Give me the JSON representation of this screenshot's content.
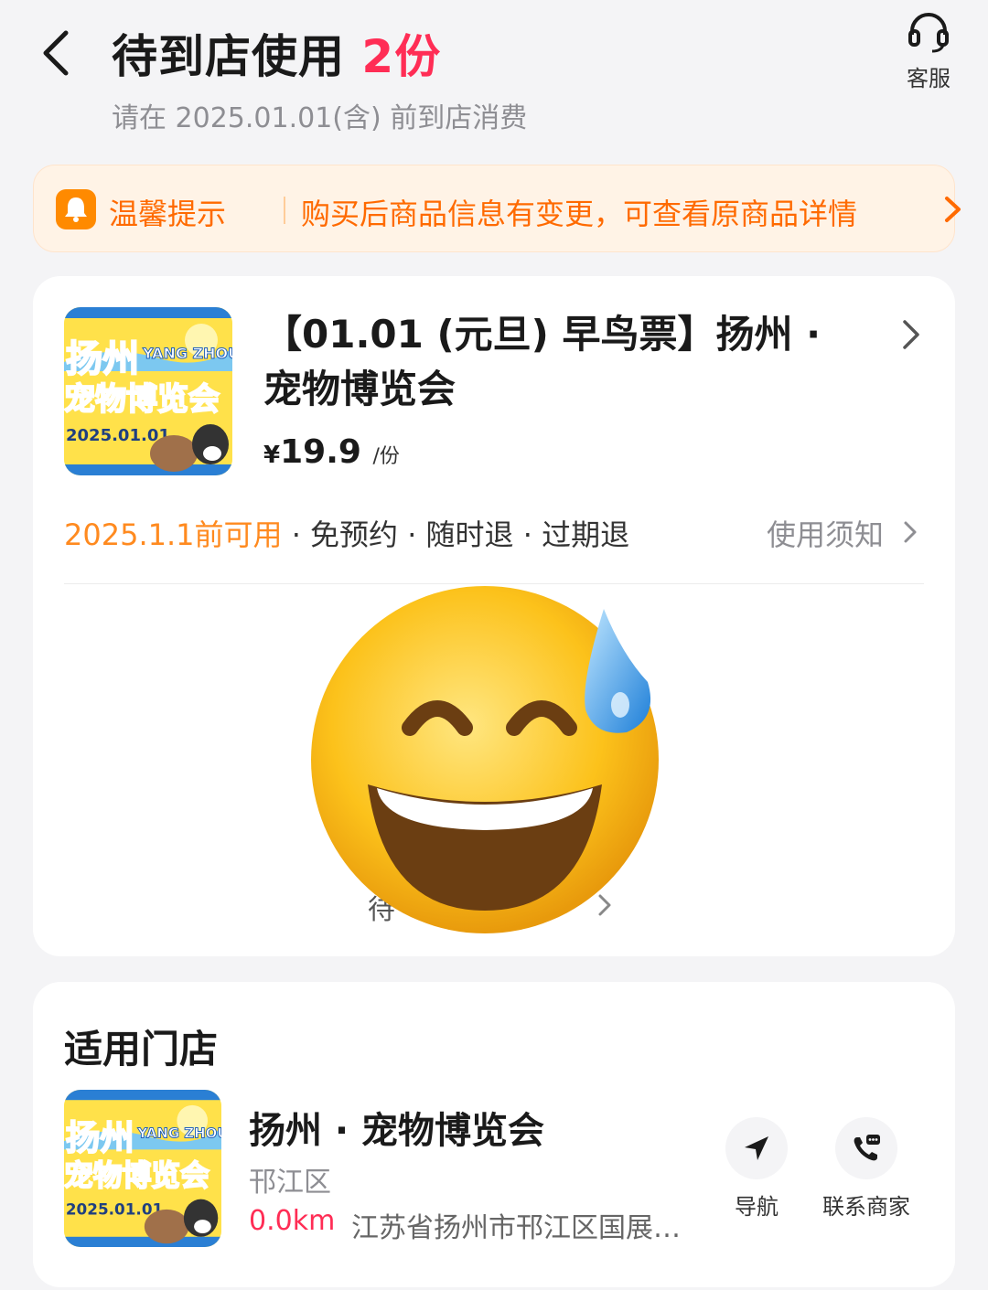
{
  "header": {
    "title": "待到店使用",
    "count": "2份",
    "subtitle": "请在 2025.01.01(含) 前到店消费",
    "customer_service_label": "客服"
  },
  "notice": {
    "title": "温馨提示",
    "text": "购买后商品信息有变更，可查看原商品详情"
  },
  "product": {
    "title": "【01.01 (元旦) 早鸟票】扬州 · 宠物博览会",
    "price_symbol": "¥",
    "price": "19.9",
    "price_unit": "/份",
    "availability": "2025.1.1前可用",
    "rules": " · 免预约 · 随时退 · 过期退",
    "usage_notice": "使用须知",
    "poster": {
      "line1": "扬州",
      "line2": "YANG ZHOU",
      "line3": "宠物博览会",
      "date": "2025.01.01"
    },
    "obscured_text": "待"
  },
  "stores": {
    "section_title": "适用门店",
    "name": "扬州 · 宠物博览会",
    "district": "邗江区",
    "distance": "0.0km",
    "address": "江苏省扬州市邗江区国展…",
    "navigate_label": "导航",
    "contact_label": "联系商家"
  },
  "colors": {
    "accent_red": "#ff2d55",
    "accent_orange": "#ff8a1f",
    "notice_bg": "#fff3e6"
  }
}
